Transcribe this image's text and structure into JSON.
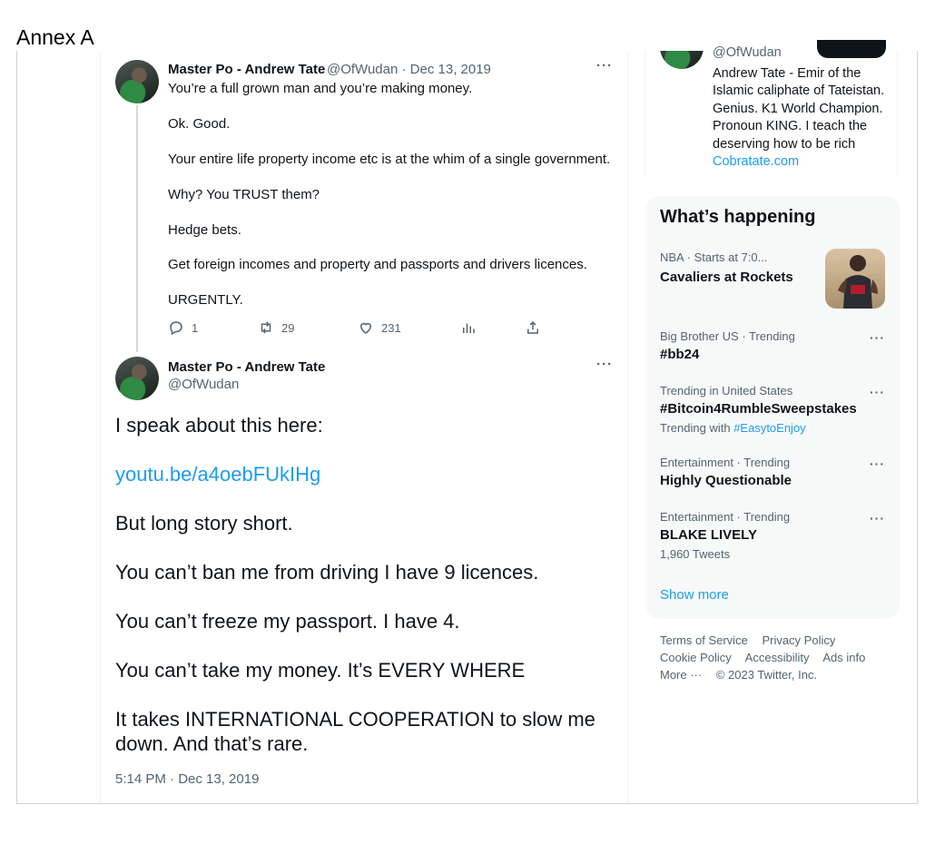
{
  "annex_label": "Annex A",
  "tweet1": {
    "name": "Master Po - Andrew Tate",
    "handle": "@OfWudan",
    "date": "· Dec 13, 2019",
    "lines": [
      "You’re a full grown man and you’re making money.",
      "Ok. Good.",
      "Your entire life property income etc is at the whim of a single government.",
      "Why? You TRUST them?",
      "Hedge bets.",
      "Get foreign incomes and property and passports and drivers licences.",
      "URGENTLY."
    ],
    "replies": "1",
    "retweets": "29",
    "likes": "231"
  },
  "tweet2": {
    "name": "Master Po - Andrew Tate",
    "handle": "@OfWudan",
    "lines": [
      "I speak about this here:",
      "youtu.be/a4oebFUkIHg",
      "But long story short.",
      "You can’t ban me from driving I have 9 licences.",
      "You can’t freeze my passport. I have 4.",
      "You can’t take my money. It’s EVERY WHERE",
      "It takes INTERNATIONAL COOPERATION to slow me",
      "down. And that’s rare."
    ],
    "timestamp": "5:14 PM · Dec 13, 2019"
  },
  "profile_card": {
    "handle": "@OfWudan",
    "bio": "Andrew Tate - Emir of the Islamic caliphate of Tateistan. Genius. K1 World Champion. Pronoun KING. I teach the deserving how to be rich",
    "bio_link": "Cobratate.com"
  },
  "trends": {
    "title": "What’s happening",
    "items": [
      {
        "context": "NBA · Starts at 7:0...",
        "name": "Cavaliers at Rockets",
        "sub": ""
      },
      {
        "context": "Big Brother US · Trending",
        "name": "#bb24",
        "sub": ""
      },
      {
        "context": "Trending in United States",
        "name": "#Bitcoin4RumbleSweepstakes",
        "sub_prefix": "Trending with",
        "sub_tag": "#EasytoEnjoy"
      },
      {
        "context": "Entertainment · Trending",
        "name": "Highly Questionable",
        "sub": ""
      },
      {
        "context": "Entertainment · Trending",
        "name": "BLAKE LIVELY",
        "sub": "1,960 Tweets"
      }
    ],
    "show_more": "Show more"
  },
  "footer": {
    "terms": "Terms of Service",
    "privacy": "Privacy Policy",
    "cookie": "Cookie Policy",
    "accessibility": "Accessibility",
    "ads": "Ads info",
    "more": "More ···",
    "copyright": "© 2023 Twitter, Inc."
  },
  "icons": {
    "reply": "reply-icon",
    "retweet": "retweet-icon",
    "like": "heart-icon",
    "views": "analytics-icon",
    "share": "share-icon"
  },
  "colors": {
    "link": "#1d9bf0",
    "secondary_text": "#536471",
    "primary_text": "#0f1419"
  }
}
